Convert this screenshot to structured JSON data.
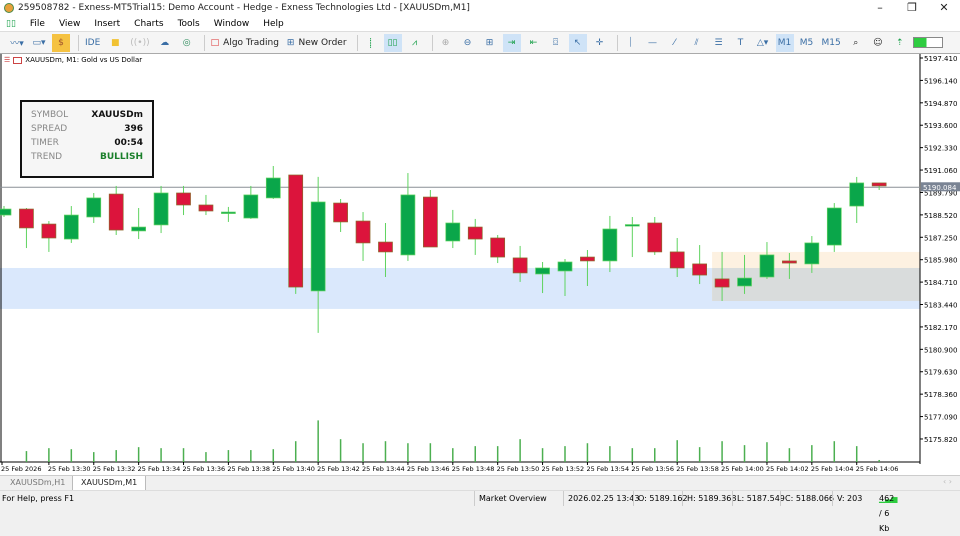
{
  "window": {
    "title": "259508782 - Exness-MT5Trial15: Demo Account - Hedge - Exness Technologies Ltd - [XAUUSDm,M1]",
    "minimize": "–",
    "maximize": "❐",
    "close": "✕"
  },
  "menu": [
    "File",
    "View",
    "Insert",
    "Charts",
    "Tools",
    "Window",
    "Help"
  ],
  "toolbar": {
    "ide": "IDE",
    "algo_trading": "Algo Trading",
    "new_order": "New Order",
    "timeframes": [
      "M1",
      "M5",
      "M15"
    ],
    "active_timeframe": "M1"
  },
  "chart": {
    "label": "XAUUSDm, M1:  Gold vs US Dollar",
    "current_price": "5190.084",
    "current_price_value": 5190.084,
    "price_ticks": [
      "5197.410",
      "5196.140",
      "5194.870",
      "5193.600",
      "5192.330",
      "5191.060",
      "5189.790",
      "5188.520",
      "5187.250",
      "5185.980",
      "5184.710",
      "5183.440",
      "5182.170",
      "5180.900",
      "5179.630",
      "5178.360",
      "5177.090",
      "5175.820"
    ],
    "time_labels": [
      "25 Feb 2026",
      "25 Feb 13:30",
      "25 Feb 13:32",
      "25 Feb 13:34",
      "25 Feb 13:36",
      "25 Feb 13:38",
      "25 Feb 13:40",
      "25 Feb 13:42",
      "25 Feb 13:44",
      "25 Feb 13:46",
      "25 Feb 13:48",
      "25 Feb 13:50",
      "25 Feb 13:52",
      "25 Feb 13:54",
      "25 Feb 13:56",
      "25 Feb 13:58",
      "25 Feb 14:00",
      "25 Feb 14:02",
      "25 Feb 14:04",
      "25 Feb 14:06"
    ],
    "colors": {
      "bull": "#0aa64a",
      "bear": "#dc143c",
      "wick": "#5fd35f",
      "zone_blue": "#dae8fc",
      "zone_orange": "#fdf1e1",
      "zone_overlap": "#d9dcdc"
    },
    "zones": [
      {
        "name": "blue",
        "from": 5185.51,
        "to": 5183.19,
        "start_index": 0
      },
      {
        "name": "orange",
        "from": 5186.42,
        "to": 5183.64,
        "start_index": 32
      }
    ]
  },
  "chart_data": {
    "type": "candlestick",
    "ylim": [
      5175.0,
      5197.9
    ],
    "candles": [
      [
        5188.51,
        5189.02,
        5188.4,
        5188.85
      ],
      [
        5188.85,
        5188.91,
        5186.64,
        5187.78
      ],
      [
        5188.0,
        5188.17,
        5186.42,
        5187.21
      ],
      [
        5187.15,
        5189.02,
        5186.93,
        5188.51
      ],
      [
        5188.4,
        5189.76,
        5188.06,
        5189.48
      ],
      [
        5189.7,
        5190.16,
        5187.38,
        5187.66
      ],
      [
        5187.61,
        5188.91,
        5187.15,
        5187.83
      ],
      [
        5187.95,
        5190.16,
        5187.49,
        5189.76
      ],
      [
        5189.76,
        5190.16,
        5188.51,
        5189.08
      ],
      [
        5189.08,
        5189.65,
        5188.51,
        5188.74
      ],
      [
        5188.63,
        5188.97,
        5188.12,
        5188.68
      ],
      [
        5188.34,
        5190.16,
        5188.29,
        5189.65
      ],
      [
        5189.48,
        5191.29,
        5189.42,
        5190.61
      ],
      [
        5190.78,
        5190.78,
        5184.04,
        5184.43
      ],
      [
        5184.21,
        5190.67,
        5181.83,
        5189.25
      ],
      [
        5189.19,
        5189.42,
        5187.55,
        5188.12
      ],
      [
        5188.17,
        5188.68,
        5185.91,
        5186.93
      ],
      [
        5186.98,
        5188.06,
        5185.0,
        5186.42
      ],
      [
        5186.25,
        5190.89,
        5185.91,
        5189.65
      ],
      [
        5189.53,
        5189.93,
        5186.7,
        5186.7
      ],
      [
        5187.04,
        5188.8,
        5186.64,
        5188.06
      ],
      [
        5187.83,
        5188.29,
        5186.25,
        5187.15
      ],
      [
        5187.21,
        5187.38,
        5185.79,
        5186.13
      ],
      [
        5186.08,
        5186.76,
        5184.72,
        5185.23
      ],
      [
        5185.17,
        5185.85,
        5184.09,
        5185.51
      ],
      [
        5185.34,
        5186.02,
        5183.92,
        5185.85
      ],
      [
        5186.13,
        5186.53,
        5184.49,
        5185.91
      ],
      [
        5185.91,
        5188.46,
        5185.28,
        5187.72
      ],
      [
        5187.95,
        5188.4,
        5186.13,
        5187.97
      ],
      [
        5188.06,
        5188.4,
        5186.25,
        5186.42
      ],
      [
        5186.42,
        5187.21,
        5185.0,
        5185.51
      ],
      [
        5185.74,
        5186.81,
        5184.6,
        5185.11
      ],
      [
        5184.89,
        5186.42,
        5183.64,
        5184.43
      ],
      [
        5184.49,
        5186.25,
        5184.04,
        5184.94
      ],
      [
        5185.0,
        5186.98,
        5184.89,
        5186.25
      ],
      [
        5185.91,
        5186.36,
        5184.89,
        5185.79
      ],
      [
        5185.74,
        5187.32,
        5185.23,
        5186.93
      ],
      [
        5186.81,
        5189.19,
        5186.42,
        5188.91
      ],
      [
        5189.02,
        5190.67,
        5188.06,
        5190.33
      ],
      [
        5190.33,
        5190.33,
        5189.93,
        5190.16
      ]
    ],
    "volumes": [
      0,
      97,
      123,
      114,
      88,
      106,
      132,
      123,
      123,
      88,
      106,
      106,
      114,
      185,
      370,
      203,
      167,
      185,
      167,
      167,
      123,
      141,
      141,
      203,
      123,
      141,
      167,
      141,
      123,
      123,
      194,
      132,
      185,
      150,
      176,
      123,
      150,
      185,
      141,
      18
    ],
    "volume_max": 400
  },
  "info_panel": [
    {
      "k": "SYMBOL",
      "v": "XAUUSDm",
      "c": "#111"
    },
    {
      "k": "SPREAD",
      "v": "396",
      "c": "#111"
    },
    {
      "k": "TIMER",
      "v": "00:54",
      "c": "#111"
    },
    {
      "k": "TREND",
      "v": "BULLISH",
      "c": "#1a7f2a"
    }
  ],
  "tabs": [
    {
      "label": "XAUUSDm,H1",
      "active": false
    },
    {
      "label": "XAUUSDm,M1",
      "active": true
    }
  ],
  "status": {
    "help": "For Help, press F1",
    "market": "Market Overview",
    "time": "2026.02.25 13:43",
    "open": "O: 5189.162",
    "high": "H: 5189.368",
    "low": "L: 5187.549",
    "close": "C: 5188.066",
    "volume": "V: 203",
    "traffic": "462 / 6 Kb"
  }
}
